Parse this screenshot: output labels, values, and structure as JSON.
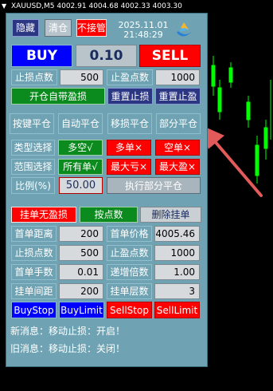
{
  "chart_header": {
    "symbol": "XAUUSD,M5",
    "open": "4002.91",
    "high": "4004.68",
    "low": "4002.33",
    "close": "4003.30"
  },
  "top_row": {
    "hide_label": "隐藏",
    "clear_label": "清仓",
    "no_manage_label": "不接管",
    "date": "2025.11.01",
    "time": "21:48:29"
  },
  "trade": {
    "buy_label": "BUY",
    "lot_value": "0.10",
    "sell_label": "SELL"
  },
  "sl_tp": {
    "sl_points_label": "止损点数",
    "sl_points_value": "500",
    "tp_points_label": "止盈点数",
    "tp_points_value": "1000",
    "auto_sltp_label": "开仓自带盈损",
    "reset_sl_label": "重置止损",
    "reset_tp_label": "重置止盈"
  },
  "close_modes": {
    "key_close": "按键平仓",
    "auto_close": "自动平仓",
    "trail_close": "移损平仓",
    "partial_close": "部分平仓"
  },
  "filters": {
    "type_select_label": "类型选择",
    "long_short": "多空√",
    "long_only": "多单×",
    "short_only": "空单×",
    "range_select_label": "范围选择",
    "all_orders": "所有单√",
    "max_loss": "最大亏×",
    "max_profit": "最大盈×",
    "ratio_label": "比例(%)",
    "ratio_value": "50.00",
    "execute_partial_label": "执行部分平仓"
  },
  "pending": {
    "no_sltp_label": "挂单无盈损",
    "by_points_label": "按点数",
    "delete_pending_label": "删除挂单",
    "first_distance_label": "首单距离",
    "first_distance_value": "200",
    "first_price_label": "首单价格",
    "first_price_value": "4005.46",
    "sl_points_label": "止损点数",
    "sl_points_value": "500",
    "tp_points_label": "止盈点数",
    "tp_points_value": "1000",
    "first_lot_label": "首单手数",
    "first_lot_value": "0.01",
    "multiplier_label": "递增倍数",
    "multiplier_value": "1.00",
    "spacing_label": "挂单间距",
    "spacing_value": "200",
    "levels_label": "挂单层数",
    "levels_value": "3"
  },
  "order_buttons": {
    "buy_stop": "BuyStop",
    "buy_limit": "BuyLimit",
    "sell_stop": "SellStop",
    "sell_limit": "SellLimit"
  },
  "messages": {
    "new_msg": "新消息：移动止损：开启！",
    "old_msg": "旧消息：移动止损：关闭！"
  },
  "colors": {
    "panel_bg": "#6fa3b3",
    "buy_blue": "#0000ff",
    "sell_red": "#ff0000",
    "active_green": "#0b8a1e",
    "annotation_arrow": "#e35a5a"
  }
}
